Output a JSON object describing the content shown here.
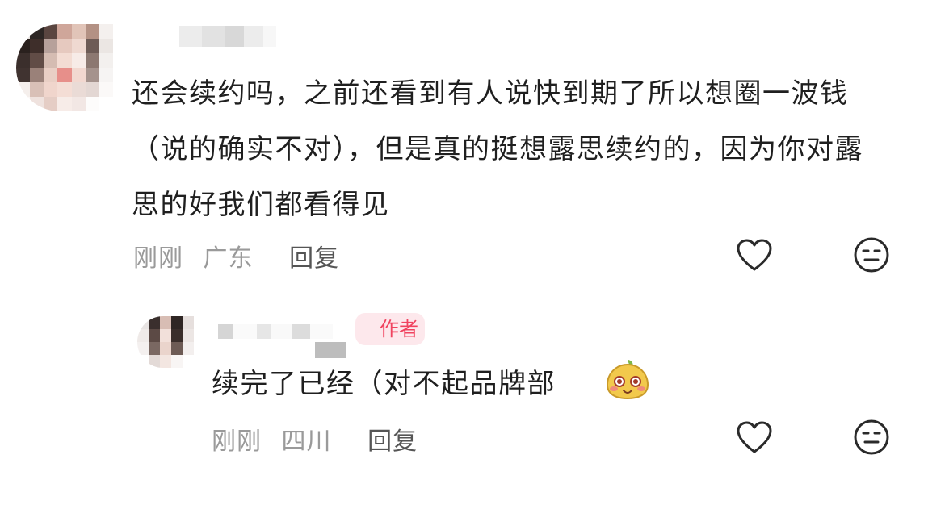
{
  "comment_main": {
    "text": "还会续约吗，之前还看到有人说快到期了所以想圈一波钱（说的确实不对），但是真的挺想露思续约的，因为你对露思的好我们都看得见",
    "time": "刚刚",
    "location": "广东",
    "reply_label": "回复",
    "like_icon": "heart-outline-icon",
    "reaction_icon": "meh-face-icon"
  },
  "comment_reply": {
    "badge": "作者",
    "text": "续完了已经（对不起品牌部",
    "emoji": "fruit-blush-emoji",
    "time": "刚刚",
    "location": "四川",
    "reply_label": "回复",
    "like_icon": "heart-outline-icon",
    "reaction_icon": "meh-face-icon"
  },
  "colors": {
    "badge_text": "#f0435f",
    "badge_bg": "#fde8ec",
    "meta_text": "#9a9a9a",
    "body_text": "#1f1f1f"
  }
}
